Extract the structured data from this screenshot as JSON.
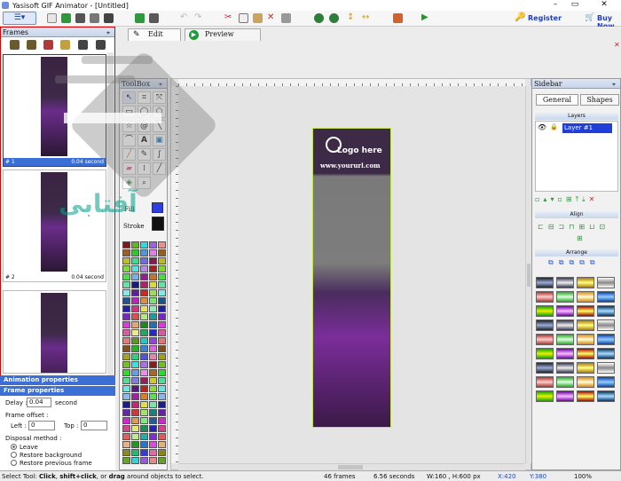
{
  "window": {
    "title": "Yasisoft GIF Animator - [Untitled]"
  },
  "toolbar": {
    "register_label": "Register",
    "buy_label": "Buy Now"
  },
  "tabs": [
    {
      "label": "Edit"
    },
    {
      "label": "Preview"
    }
  ],
  "frames_panel": {
    "title": "Frames",
    "frames": [
      {
        "index": "# 1",
        "time": "0.04 second",
        "selected": true
      },
      {
        "index": "# 2",
        "time": "0.04 second",
        "selected": false
      },
      {
        "index": "",
        "time": "",
        "selected": false
      }
    ]
  },
  "properties": {
    "animation_label": "Animation properties",
    "frame_label": "Frame properties",
    "delay_label": "Delay :",
    "delay_value": "0.04",
    "delay_unit": "second",
    "offset_label": "Frame offset :",
    "left_label": "Left :",
    "left_value": "0",
    "top_label": "Top :",
    "top_value": "0",
    "disposal_label": "Disposal method :",
    "disposal_options": [
      "Leave",
      "Restore background",
      "Restore previous frame"
    ],
    "disposal_selected": "Leave"
  },
  "toolbox": {
    "title": "ToolBox",
    "fill_label": "Fill",
    "stroke_label": "Stroke",
    "fill_color": "#2d3fe0",
    "stroke_color": "#111111"
  },
  "canvas": {
    "logo_text": "Logo here",
    "url_text": "www.yoururl.com"
  },
  "sidebar": {
    "title": "Sidebar",
    "tab_general": "General",
    "tab_shapes": "Shapes",
    "layers_label": "Layers",
    "layer_name": "Layer #1",
    "align_label": "Align",
    "arrange_label": "Arrange"
  },
  "status": {
    "hint_prefix": "Select Tool: ",
    "hint_click": "Click",
    "hint_mid": ", ",
    "hint_shift": "shift+click",
    "hint_or": ", or ",
    "hint_drag": "drag",
    "hint_suffix": " around objects to select.",
    "frames_count": "46 frames",
    "duration": "6.56 seconds",
    "size": "W:160 , H:600 px",
    "x": "X:420",
    "y": "Y:380",
    "zoom": "100%"
  },
  "watermark": {
    "text": "آفتابی"
  }
}
